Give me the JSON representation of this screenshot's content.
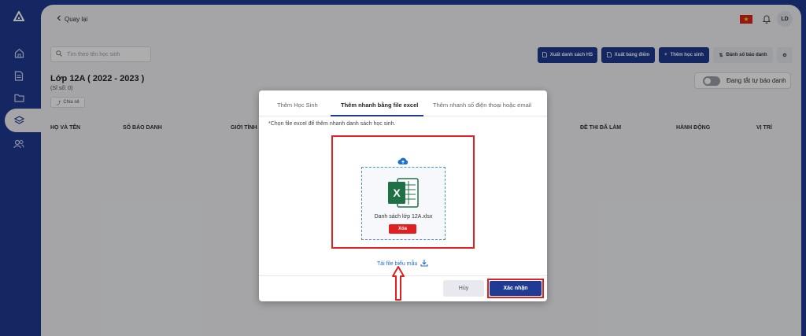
{
  "header": {
    "back_label": "Quay lại",
    "avatar_initials": "LD",
    "flag_star": "★"
  },
  "toolbar": {
    "search_placeholder": "Tìm theo tên học sinh",
    "export_list_label": "Xuất danh sách HS",
    "export_scores_label": "Xuất bảng điểm",
    "add_student_label": "Thêm học sinh",
    "number_label": "Đánh số báo danh"
  },
  "class_info": {
    "title": "Lớp 12A ( 2022 - 2023 )",
    "size": "(Sĩ số: 0)",
    "share_label": "Chia sẻ",
    "toggle_label": "Đang tắt tự báo danh"
  },
  "table": {
    "headers": [
      "HỌ VÀ TÊN",
      "SỐ BÁO DANH",
      "GIỚI TÍNH",
      "ĐỀ THI ĐÃ LÀM",
      "HÀNH ĐỘNG",
      "VỊ TRÍ"
    ]
  },
  "modal": {
    "tabs": [
      "Thêm Học Sinh",
      "Thêm nhanh bằng file excel",
      "Thêm nhanh số điện thoại hoặc email"
    ],
    "hint": "*Chọn file excel để thêm nhanh danh sách học sinh.",
    "file_name": "Danh sách lớp 12A.xlsx",
    "delete_label": "Xóa",
    "template_link": "Tải file biểu mẫu",
    "cancel_label": "Hủy",
    "confirm_label": "Xác nhận"
  },
  "colors": {
    "brand": "#1f3a93",
    "highlight": "#e02020",
    "link": "#1d6fd1",
    "excel_green": "#1e7145"
  }
}
